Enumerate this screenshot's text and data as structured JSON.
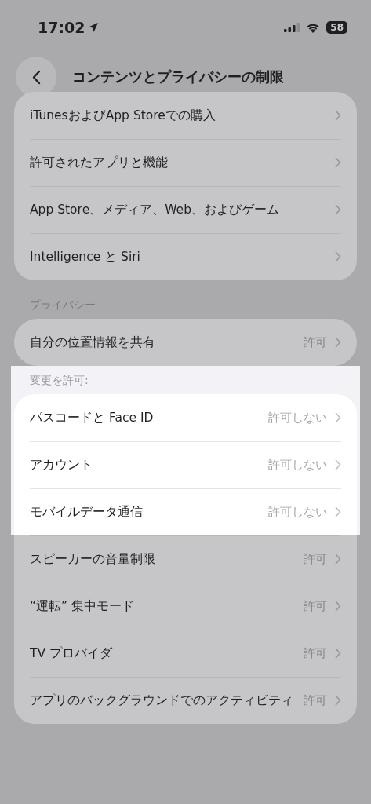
{
  "status_bar": {
    "time": "17:02",
    "battery": "58"
  },
  "nav": {
    "title": "コンテンツとプライバシーの制限"
  },
  "sections": [
    {
      "rows": [
        {
          "label": "iTunesおよびApp Storeでの購入",
          "highlighted": false
        },
        {
          "label": "許可されたアプリと機能",
          "highlighted": false
        },
        {
          "label": "App Store、メディア、Web、およびゲーム",
          "highlighted": false
        },
        {
          "label": "Intelligence と Siri",
          "highlighted": false
        }
      ]
    },
    {
      "header": "プライバシー",
      "header_highlighted": false,
      "rows": [
        {
          "label": "自分の位置情報を共有",
          "value": "許可",
          "highlighted": false
        }
      ]
    },
    {
      "header": "変更を許可:",
      "header_highlighted": true,
      "rows": [
        {
          "label": "パスコードと Face ID",
          "value": "許可しない",
          "highlighted": true
        },
        {
          "label": "アカウント",
          "value": "許可しない",
          "highlighted": true
        },
        {
          "label": "モバイルデータ通信",
          "value": "許可しない",
          "highlighted": true
        },
        {
          "label": "スピーカーの音量制限",
          "value": "許可",
          "highlighted": false
        },
        {
          "label": "“運転” 集中モード",
          "value": "許可",
          "highlighted": false
        },
        {
          "label": "TV プロバイダ",
          "value": "許可",
          "highlighted": false
        },
        {
          "label": "アプリのバックグラウンドでのアクティビティ",
          "value": "許可",
          "highlighted": false
        }
      ]
    }
  ]
}
